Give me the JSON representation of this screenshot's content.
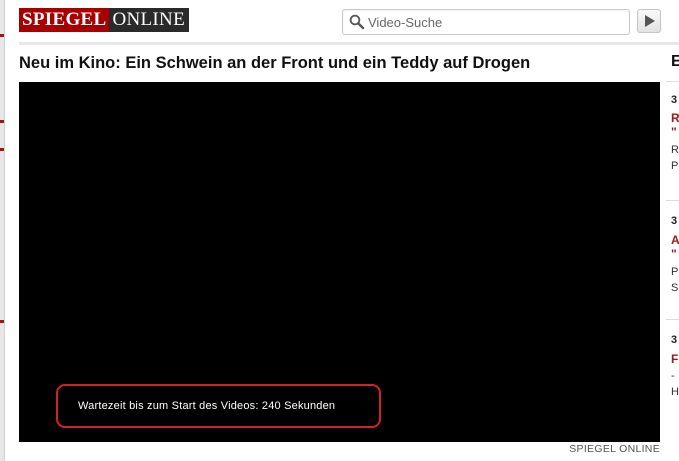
{
  "header": {
    "logo_part1": "SPIEGEL",
    "logo_part2": "ONLINE",
    "search_placeholder": "Video-Suche",
    "search_button_icon": "play-triangle-icon"
  },
  "main": {
    "title": "Neu im Kino: Ein Schwein an der Front und ein Teddy auf Drogen",
    "video": {
      "wait_message": "Wartezeit bis zum Start des Videos: 240 Sekunden",
      "credit": "SPIEGEL ONLINE"
    }
  },
  "sidebar": {
    "heading": "E",
    "items": [
      {
        "date": "3",
        "title": "R",
        "title2": "\"",
        "lines": [
          "R",
          "P"
        ]
      },
      {
        "date": "3",
        "title": "A",
        "title2": "\"",
        "lines": [
          "P",
          "S"
        ]
      },
      {
        "date": "3",
        "title": "F",
        "title2": "-",
        "lines": [
          "H"
        ]
      }
    ]
  },
  "colors": {
    "brand_red": "#a80000",
    "logo_dark": "#2a2a2a",
    "highlight_red": "#d4202a",
    "video_bg": "#000000"
  }
}
